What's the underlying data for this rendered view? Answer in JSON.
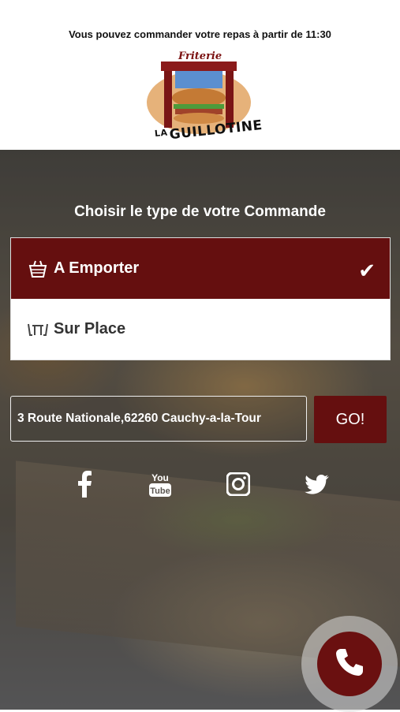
{
  "header": {
    "notice": "Vous pouvez commander votre repas à partir de 11:30",
    "logo_top": "Friterie",
    "logo_la": "LA",
    "logo_bottom": "GUILLOTINE"
  },
  "order": {
    "heading": "Choisir le type de votre Commande",
    "options": [
      {
        "label": "A Emporter",
        "icon": "basket-icon",
        "selected": true
      },
      {
        "label": "Sur Place",
        "icon": "table-icon",
        "selected": false
      }
    ]
  },
  "address": {
    "value": "3 Route Nationale,62260 Cauchy-a-la-Tour",
    "go_label": "GO!"
  },
  "social": [
    "facebook-icon",
    "youtube-icon",
    "instagram-icon",
    "twitter-icon"
  ],
  "colors": {
    "brand": "#650f0f",
    "white": "#ffffff"
  }
}
